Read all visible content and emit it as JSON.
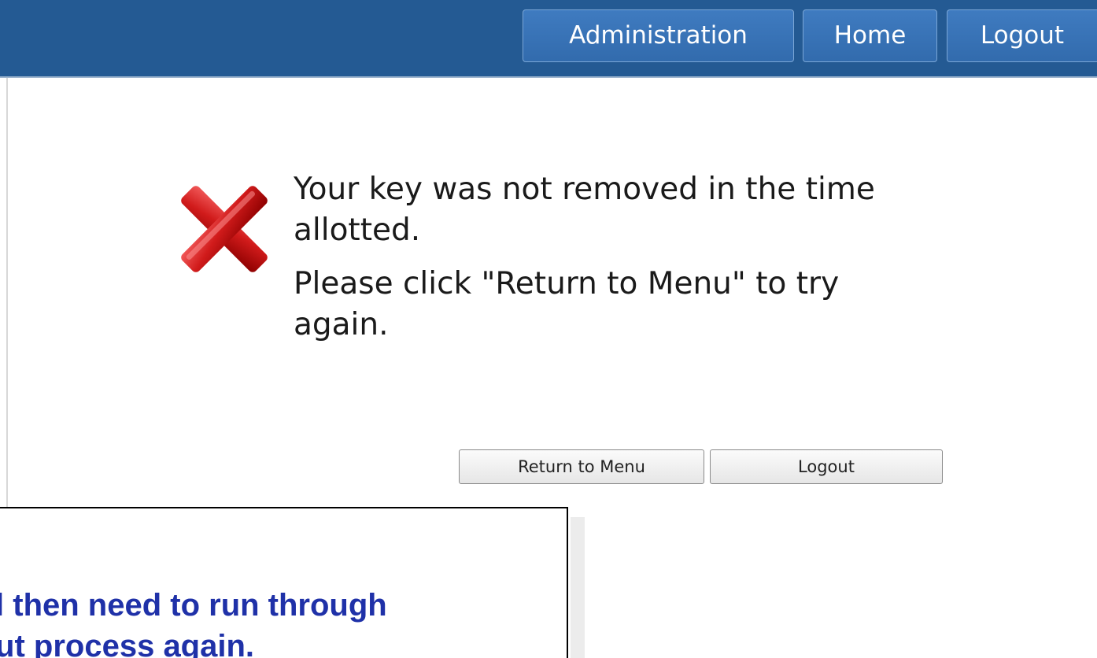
{
  "header": {
    "nav": {
      "administration": "Administration",
      "home": "Home",
      "logout": "Logout"
    },
    "colors": {
      "bar": "#245a93",
      "button": "#3a74b8"
    }
  },
  "dialog": {
    "icon": "error-x-icon",
    "message_line1": "Your key was not removed in the time allotted.",
    "message_line2": "Please click \"Return to Menu\" to try again.",
    "buttons": {
      "return_to_menu": "Return to Menu",
      "logout": "Logout"
    }
  },
  "callout": {
    "line1": "r will then need to run through",
    "line2": "ck out process again.",
    "color": "#1f31a8"
  }
}
